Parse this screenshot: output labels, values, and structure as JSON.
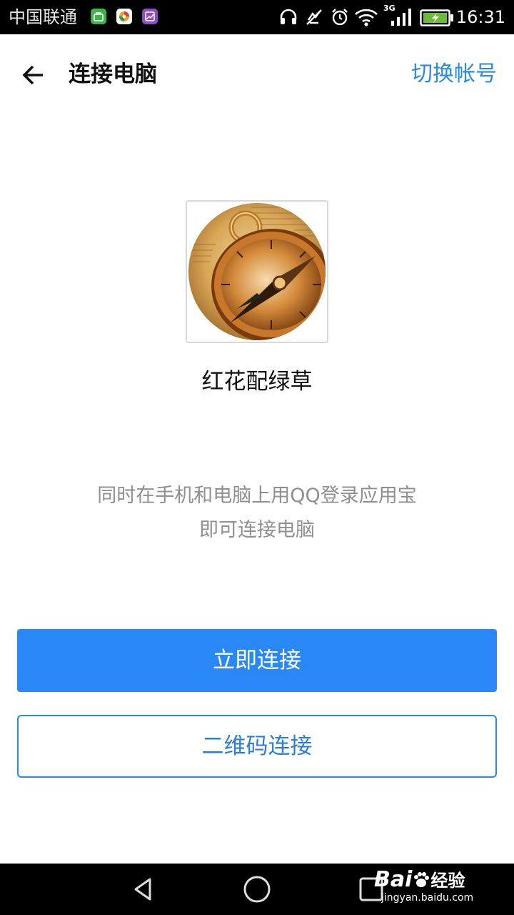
{
  "status_bar": {
    "carrier": "中国联通",
    "network_type": "3G",
    "time": "16:31",
    "icons": [
      "notification-app-icon",
      "notification-app-icon",
      "notification-gallery-icon",
      "headphones-icon",
      "vibrate-off-icon",
      "alarm-icon",
      "wifi-icon",
      "signal-icon",
      "battery-charging-icon"
    ]
  },
  "app_bar": {
    "title": "连接电脑",
    "switch_account": "切换帐号",
    "back_icon": "arrow-left-icon"
  },
  "profile": {
    "username": "红花配绿草",
    "avatar": "compass-avatar"
  },
  "hint": {
    "line1": "同时在手机和电脑上用QQ登录应用宝",
    "line2": "即可连接电脑"
  },
  "actions": {
    "connect_now": "立即连接",
    "qr_connect": "二维码连接"
  },
  "nav_bar": {
    "icons": [
      "nav-back-icon",
      "nav-home-icon",
      "nav-recent-icon"
    ]
  },
  "watermark": {
    "logo": "Bai",
    "logo_suffix": "经验",
    "url": "jingyan.baidu.com"
  },
  "colors": {
    "accent": "#2a88f6",
    "link": "#2a88e6",
    "hint_text": "#8f8f8f"
  }
}
